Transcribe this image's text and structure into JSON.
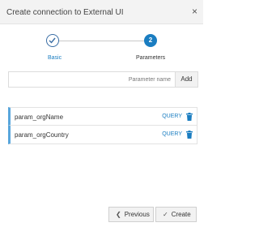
{
  "dialog": {
    "title": "Create connection to External UI",
    "close_glyph": "×"
  },
  "wizard": {
    "steps": [
      {
        "label": "Basic",
        "state": "completed",
        "icon": "check-icon"
      },
      {
        "label": "Parameters",
        "number": "2",
        "state": "active"
      }
    ],
    "accent_color": "#1a7dc1"
  },
  "param_input": {
    "placeholder": "Parameter name",
    "value": "",
    "add_label": "Add"
  },
  "parameters": [
    {
      "name": "param_orgName",
      "type": "QUERY"
    },
    {
      "name": "param_orgCountry",
      "type": "QUERY"
    }
  ],
  "footer": {
    "previous_label": "Previous",
    "create_label": "Create"
  }
}
